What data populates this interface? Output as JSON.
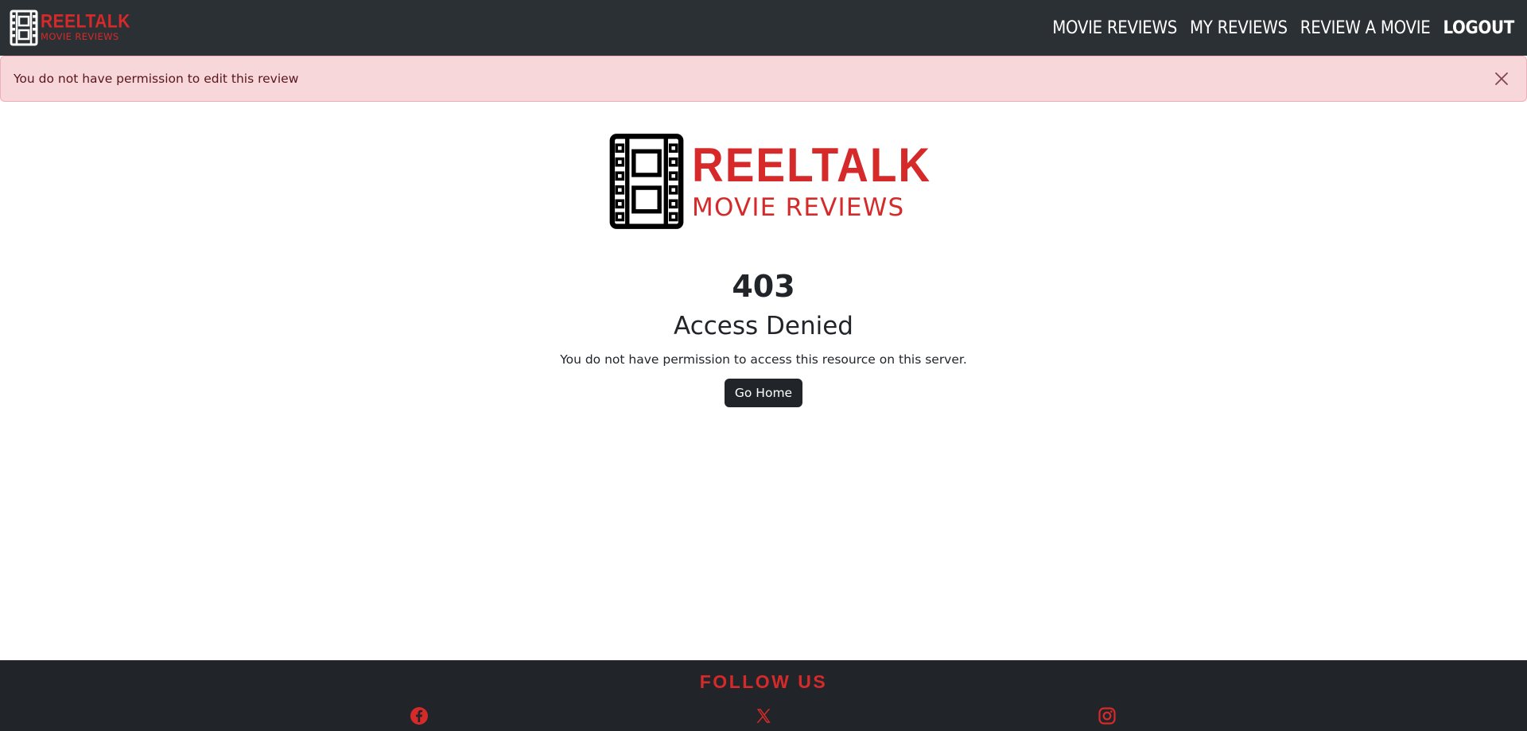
{
  "brand": {
    "title": "REELTALK",
    "subtitle": "MOVIE REVIEWS",
    "color": "#d62a2a"
  },
  "nav": {
    "items": [
      {
        "label": "Movie Reviews",
        "active": false
      },
      {
        "label": "My Reviews",
        "active": false
      },
      {
        "label": "Review a Movie",
        "active": false
      },
      {
        "label": "Logout",
        "active": true
      }
    ]
  },
  "alert": {
    "message": "You do not have permission to edit this review",
    "close_icon": "close-icon"
  },
  "error": {
    "code": "403",
    "title": "Access Denied",
    "description": "You do not have permission to access this resource on this server.",
    "button_label": "Go Home"
  },
  "footer": {
    "title": "FOLLOW US",
    "social": [
      {
        "name": "facebook-icon"
      },
      {
        "name": "x-icon"
      },
      {
        "name": "instagram-icon"
      }
    ]
  },
  "colors": {
    "navbar_bg": "#2b3035",
    "footer_bg": "#212529",
    "alert_bg": "#f8d7da",
    "alert_text": "#58151c",
    "accent": "#d62a2a"
  }
}
